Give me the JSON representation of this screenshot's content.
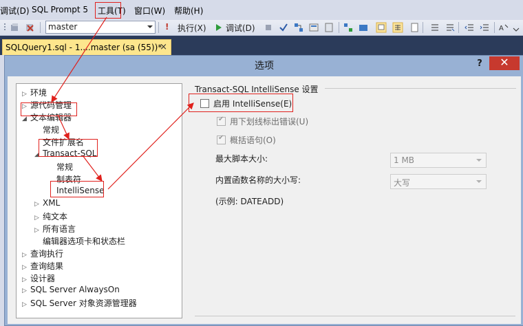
{
  "menubar": {
    "items": [
      "调试(D)",
      "SQL Prompt 5",
      "工具(T)",
      "窗口(W)",
      "帮助(H)"
    ]
  },
  "toolbar": {
    "database": "master",
    "execute_label": "执行(X)",
    "debug_label": "调试(D)"
  },
  "document_tab": {
    "label": "SQLQuery1.sql - 1....master (sa (55))*",
    "close": "×"
  },
  "dialog": {
    "title": "选项",
    "help": "?",
    "close": "✕"
  },
  "tree": {
    "items": [
      {
        "label": "环境",
        "expander": "▷"
      },
      {
        "label": "源代码管理",
        "expander": "▷"
      },
      {
        "label": "文本编辑器",
        "expander": "◢"
      },
      {
        "label": "常规",
        "expander": ""
      },
      {
        "label": "文件扩展名",
        "expander": ""
      },
      {
        "label": "Transact-SQL",
        "expander": "◢"
      },
      {
        "label": "常规",
        "expander": ""
      },
      {
        "label": "制表符",
        "expander": ""
      },
      {
        "label": "IntelliSense",
        "expander": ""
      },
      {
        "label": "XML",
        "expander": "▷"
      },
      {
        "label": "纯文本",
        "expander": "▷"
      },
      {
        "label": "所有语言",
        "expander": "▷"
      },
      {
        "label": "编辑器选项卡和状态栏",
        "expander": ""
      },
      {
        "label": "查询执行",
        "expander": "▷"
      },
      {
        "label": "查询结果",
        "expander": "▷"
      },
      {
        "label": "设计器",
        "expander": "▷"
      },
      {
        "label": "SQL Server AlwaysOn",
        "expander": "▷"
      },
      {
        "label": "SQL Server 对象资源管理器",
        "expander": "▷"
      }
    ]
  },
  "settings": {
    "group_title": "Transact-SQL IntelliSense 设置",
    "enable_intellisense": {
      "label": "启用 IntelliSense(E)",
      "checked": false
    },
    "underline_errors": {
      "label": "用下划线标出错误(U)",
      "checked": true
    },
    "outline_statements": {
      "label": "概括语句(O)",
      "checked": true
    },
    "max_script_size_label": "最大脚本大小:",
    "max_script_size_value": "1 MB",
    "casing_label": "内置函数名称的大小写:",
    "casing_value": "大写",
    "example": "(示例: DATEADD)"
  },
  "colors": {
    "annotation": "#e0201c",
    "tab_active": "#fde68d",
    "dialog_frame": "#98b1d4"
  }
}
